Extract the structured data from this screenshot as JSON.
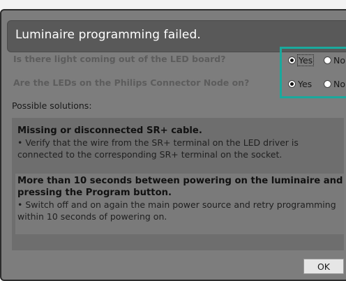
{
  "dialog": {
    "title": "Luminaire programming failed."
  },
  "questions": [
    {
      "text": "Is there light coming out of the LED board?",
      "yes_label": "Yes",
      "no_label": "No",
      "selected": "Yes"
    },
    {
      "text": "Are the LEDs on the Philips Connector Node on?",
      "yes_label": "Yes",
      "no_label": "No",
      "selected": "Yes"
    }
  ],
  "solutions": {
    "heading": "Possible solutions:",
    "items": [
      {
        "title": "Missing or disconnected SR+ cable.",
        "detail": "• Verify that the wire from the SR+ terminal on the LED driver is connected to the corresponding SR+ terminal on the socket."
      },
      {
        "title": "More than 10 seconds between powering on the luminaire and pressing the Program button.",
        "detail": "• Switch off and on again the main power source and retry programming within 10 seconds of powering on."
      }
    ]
  },
  "buttons": {
    "ok_label": "OK"
  },
  "colors": {
    "focus_border": "#1aa99d",
    "title_bar": "#595959",
    "dialog_bg": "#7d7d7d"
  }
}
